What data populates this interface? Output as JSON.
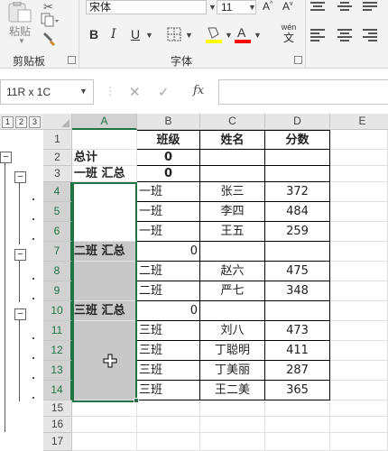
{
  "ribbon": {
    "clipboard": {
      "paste_label": "粘贴",
      "group_label": "剪贴板"
    },
    "font": {
      "font_name": "宋体",
      "font_size": "11",
      "group_label": "字体",
      "bold": "B",
      "italic": "I",
      "underline": "U",
      "wen_top": "wén",
      "wen_bottom": "文"
    },
    "colors": {
      "fill": "#ffff00",
      "font": "#ff0000",
      "accent": "#217346"
    }
  },
  "formula_bar": {
    "name_box": "11R x 1C",
    "fx": "fx",
    "value": ""
  },
  "outline_levels": [
    "1",
    "2",
    "3"
  ],
  "columns": [
    "A",
    "B",
    "C",
    "D",
    "E"
  ],
  "rows": [
    "1",
    "2",
    "3",
    "4",
    "5",
    "6",
    "7",
    "8",
    "9",
    "10",
    "11",
    "12",
    "13",
    "14",
    "15",
    "16",
    "17"
  ],
  "cells": {
    "B1": "班级",
    "C1": "姓名",
    "D1": "分数",
    "A2": "总计",
    "B2": "0",
    "A3": "一班 汇总",
    "B3": "0",
    "B4": "一班",
    "C4": "张三",
    "D4": "372",
    "B5": "一班",
    "C5": "李四",
    "D5": "484",
    "B6": "一班",
    "C6": "王五",
    "D6": "259",
    "A7": "二班 汇总",
    "B7": "0",
    "B8": "二班",
    "C8": "赵六",
    "D8": "475",
    "B9": "二班",
    "C9": "严七",
    "D9": "348",
    "A10": "三班 汇总",
    "B10": "0",
    "B11": "三班",
    "C11": "刘八",
    "D11": "473",
    "B12": "三班",
    "C12": "丁聪明",
    "D12": "411",
    "B13": "三班",
    "C13": "丁美丽",
    "D13": "287",
    "B14": "三班",
    "C14": "王二美",
    "D14": "365"
  }
}
